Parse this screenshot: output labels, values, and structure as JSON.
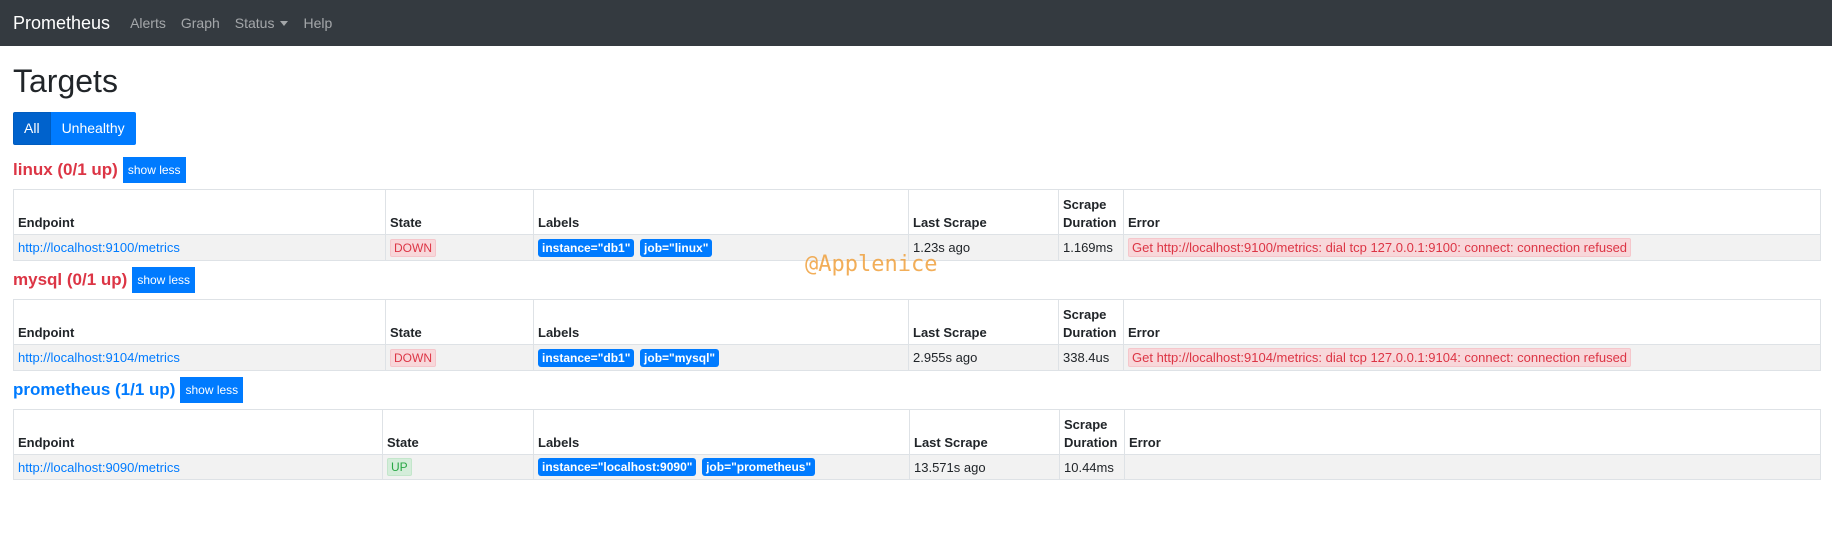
{
  "navbar": {
    "brand": "Prometheus",
    "links": [
      "Alerts",
      "Graph",
      "Status",
      "Help"
    ]
  },
  "page": {
    "title": "Targets"
  },
  "filters": {
    "all": "All",
    "unhealthy": "Unhealthy"
  },
  "columns": {
    "endpoint": "Endpoint",
    "state": "State",
    "labels": "Labels",
    "last_scrape": "Last Scrape",
    "scrape_duration_1": "Scrape",
    "scrape_duration_2": "Duration",
    "error": "Error"
  },
  "sections": [
    {
      "title": "linux (0/1 up)",
      "toggle": "show less",
      "endpoint": "http://localhost:9100/metrics",
      "state": "DOWN",
      "labels": [
        "instance=\"db1\"",
        "job=\"linux\""
      ],
      "last_scrape": "1.23s ago",
      "duration": "1.169ms",
      "error": "Get http://localhost:9100/metrics: dial tcp 127.0.0.1:9100: connect: connection refused"
    },
    {
      "title": "mysql (0/1 up)",
      "toggle": "show less",
      "endpoint": "http://localhost:9104/metrics",
      "state": "DOWN",
      "labels": [
        "instance=\"db1\"",
        "job=\"mysql\""
      ],
      "last_scrape": "2.955s ago",
      "duration": "338.4us",
      "error": "Get http://localhost:9104/metrics: dial tcp 127.0.0.1:9104: connect: connection refused"
    },
    {
      "title": "prometheus (1/1 up)",
      "toggle": "show less",
      "endpoint": "http://localhost:9090/metrics",
      "state": "UP",
      "labels": [
        "instance=\"localhost:9090\"",
        "job=\"prometheus\""
      ],
      "last_scrape": "13.571s ago",
      "duration": "10.44ms",
      "error": ""
    }
  ],
  "watermark": "@Applenice",
  "colors": {
    "navbar": "#343a40",
    "primary": "#007bff",
    "danger": "#dc3545",
    "success": "#28a745"
  }
}
